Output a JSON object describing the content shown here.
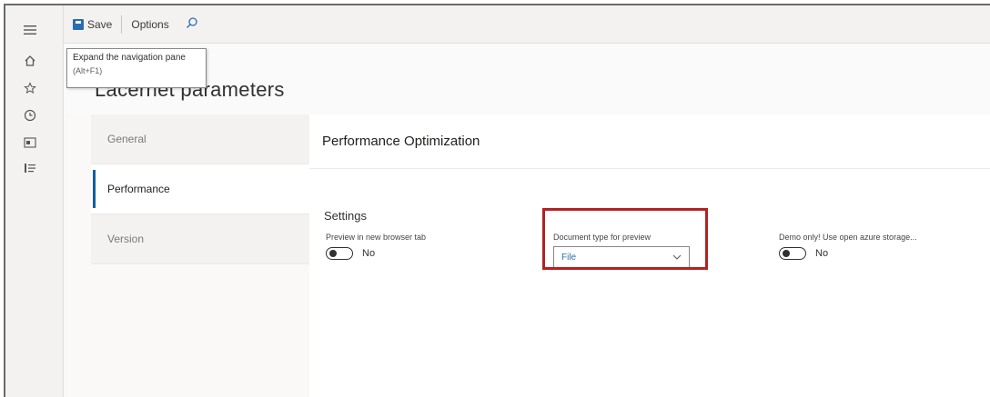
{
  "toolbar": {
    "save_label": "Save",
    "options_label": "Options",
    "search_icon": "search-icon"
  },
  "tooltip": {
    "line1": "Expand the navigation pane",
    "line2": "(Alt+F1)"
  },
  "page": {
    "title": "Lacernet parameters"
  },
  "nav_rail": {
    "icons": [
      "hamburger-icon",
      "home-icon",
      "star-icon",
      "clock-icon",
      "workspace-icon",
      "list-icon"
    ]
  },
  "side_nav": {
    "items": [
      {
        "label": "General",
        "active": false
      },
      {
        "label": "Performance",
        "active": true
      },
      {
        "label": "Version",
        "active": false
      }
    ]
  },
  "panel": {
    "header": "Performance Optimization",
    "section_title": "Settings",
    "fields": {
      "preview_new_tab": {
        "label": "Preview in new browser tab",
        "value": "No"
      },
      "doc_type": {
        "label": "Document type for preview",
        "value": "File"
      },
      "demo_storage": {
        "label": "Demo only! Use open azure storage...",
        "value": "No"
      }
    }
  },
  "colors": {
    "accent": "#0f5ea8",
    "highlight": "#b22222",
    "rail_bg": "#f3f2f1"
  }
}
